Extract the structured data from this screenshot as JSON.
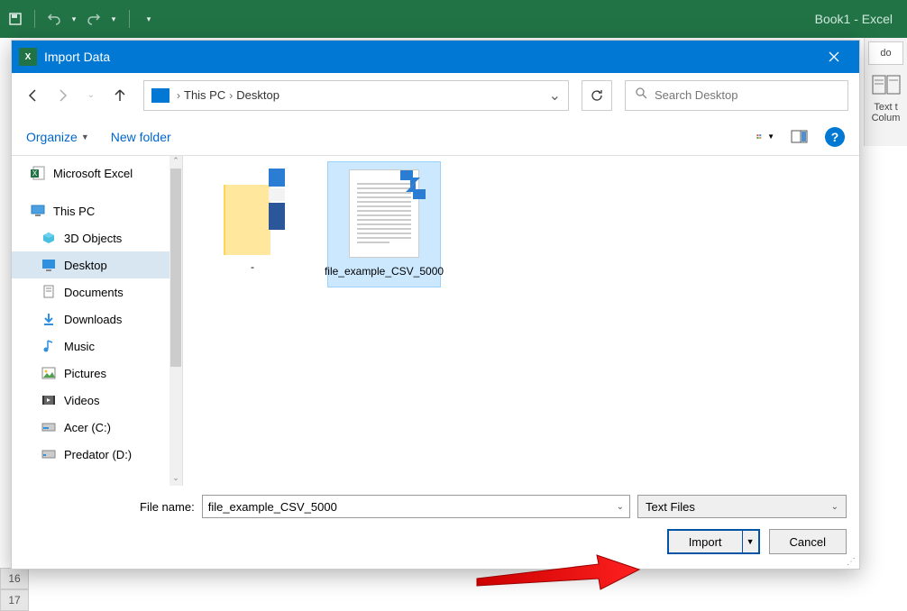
{
  "excel": {
    "title": "Book1  -  Excel",
    "right_panel": {
      "tab": "do",
      "text1": "Text t",
      "text2": "Colum"
    },
    "rows": [
      "16",
      "17"
    ]
  },
  "dialog": {
    "title": "Import Data",
    "breadcrumb": {
      "item1": "This PC",
      "item2": "Desktop"
    },
    "search": {
      "placeholder": "Search Desktop"
    },
    "toolbar": {
      "organize": "Organize",
      "newfolder": "New folder"
    },
    "sidebar": {
      "items": [
        {
          "label": "Microsoft Excel"
        },
        {
          "label": "This PC"
        },
        {
          "label": "3D Objects"
        },
        {
          "label": "Desktop"
        },
        {
          "label": "Documents"
        },
        {
          "label": "Downloads"
        },
        {
          "label": "Music"
        },
        {
          "label": "Pictures"
        },
        {
          "label": "Videos"
        },
        {
          "label": "Acer (C:)"
        },
        {
          "label": "Predator (D:)"
        }
      ]
    },
    "files": {
      "folder_name": "-",
      "csv_name": "file_example_CSV_5000"
    },
    "footer": {
      "filename_label": "File name:",
      "filename_value": "file_example_CSV_5000",
      "filter": "Text Files",
      "import": "Import",
      "cancel": "Cancel"
    }
  }
}
